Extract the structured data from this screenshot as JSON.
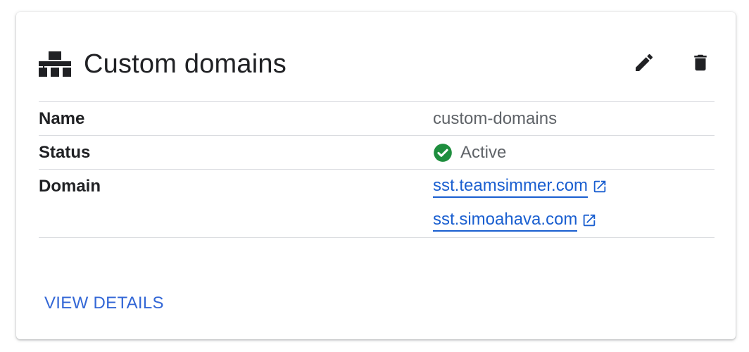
{
  "card": {
    "title": "Custom domains",
    "title_icon": "sitemap-icon",
    "actions": {
      "edit_icon": "pencil-icon",
      "delete_icon": "trash-icon"
    }
  },
  "rows": {
    "name": {
      "label": "Name",
      "value": "custom-domains"
    },
    "status": {
      "label": "Status",
      "value": "Active",
      "icon": "check-circle-icon",
      "color": "#1e8e3e"
    },
    "domain": {
      "label": "Domain",
      "links": [
        {
          "text": "sst.teamsimmer.com",
          "icon": "open-in-new-icon"
        },
        {
          "text": "sst.simoahava.com",
          "icon": "open-in-new-icon"
        }
      ]
    }
  },
  "footer": {
    "view_details_label": "VIEW DETAILS"
  },
  "colors": {
    "link": "#1a5fd0",
    "accent": "#3367d6",
    "success": "#1e8e3e",
    "divider": "#dadce0"
  }
}
